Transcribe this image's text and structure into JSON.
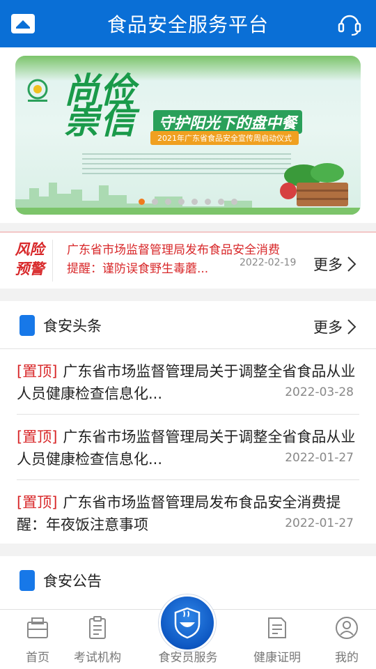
{
  "header": {
    "title": "食品安全服务平台",
    "home_icon": "home-icon",
    "service_icon": "headset-icon"
  },
  "banner": {
    "headline_line1": "尚俭",
    "headline_line2": "崇信",
    "slogan": "守护阳光下的盘中餐",
    "ceremony": "2021年广东省食品安全宣传周启动仪式",
    "slide_count": 8,
    "active_slide": 1,
    "colors": {
      "accent": "#1a9a4a",
      "dot_active": "#f07a1d"
    }
  },
  "risk_alert": {
    "badge_line1": "风险",
    "badge_line2": "预警",
    "title_line1": "广东省市场监督管理局发布食品安全消费",
    "title_line2": "提醒：谨防误食野生毒蘑...",
    "date": "2022-02-19",
    "more_label": "更多"
  },
  "news_section": {
    "title": "食安头条",
    "more_label": "更多",
    "items": [
      {
        "tag": "[置顶]",
        "text": "广东省市场监督管理局关于调整全省食品从业人员健康检查信息化...",
        "date": "2022-03-28"
      },
      {
        "tag": "[置顶]",
        "text": "广东省市场监督管理局关于调整全省食品从业人员健康检查信息化...",
        "date": "2022-01-27"
      },
      {
        "tag": "[置顶]",
        "text": "广东省市场监督管理局发布食品安全消费提醒：年夜饭注意事项",
        "date": "2022-01-27"
      }
    ]
  },
  "notice_section": {
    "title": "食安公告"
  },
  "tabbar": {
    "tabs": [
      {
        "label": "首页",
        "icon": "home-tab-icon"
      },
      {
        "label": "考试机构",
        "icon": "clipboard-icon"
      },
      {
        "label": "食安员服务",
        "icon": "shield-bowl-icon"
      },
      {
        "label": "健康证明",
        "icon": "certificate-icon"
      },
      {
        "label": "我的",
        "icon": "user-icon"
      }
    ],
    "colors": {
      "brand": "#0a6fd6"
    }
  }
}
